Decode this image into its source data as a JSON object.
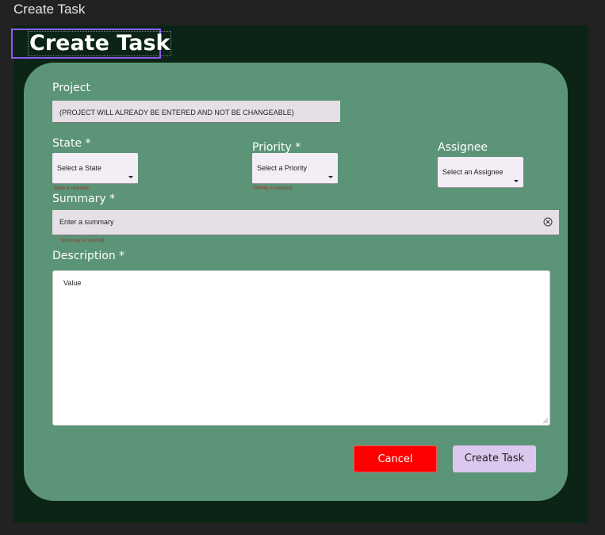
{
  "frame_label": "Create Task",
  "header": {
    "title": "Create Task"
  },
  "form": {
    "project": {
      "label": "Project",
      "value": "(PROJECT WILL ALREADY BE ENTERED AND NOT BE CHANGEABLE)"
    },
    "state": {
      "label": "State *",
      "placeholder": "Select a State",
      "error": "State is required"
    },
    "priority": {
      "label": "Priority *",
      "placeholder": "Select a Priority",
      "error": "Priority is required"
    },
    "assignee": {
      "label": "Assignee",
      "placeholder": "Select an Assignee"
    },
    "summary": {
      "label": "Summary *",
      "placeholder": "Enter a summary",
      "error": "Summary is required"
    },
    "description": {
      "label": "Description *",
      "value": "Value"
    }
  },
  "actions": {
    "cancel_label": "Cancel",
    "create_label": "Create Task"
  },
  "colors": {
    "card": "#5c9478",
    "background": "#0b2416",
    "cancel": "#ff0000",
    "create": "#dcc8ee",
    "error": "#b3261e"
  }
}
